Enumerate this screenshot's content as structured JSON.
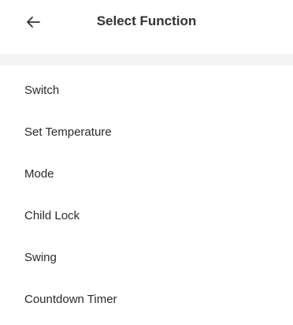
{
  "header": {
    "title": "Select Function",
    "back_icon": "arrow-left-icon"
  },
  "functions": [
    {
      "label": "Switch"
    },
    {
      "label": "Set Temperature"
    },
    {
      "label": "Mode"
    },
    {
      "label": "Child Lock"
    },
    {
      "label": "Swing"
    },
    {
      "label": "Countdown Timer"
    }
  ],
  "colors": {
    "background": "#ffffff",
    "separator": "#f3f3f3",
    "text": "#2a2a2a",
    "title": "#333333"
  }
}
